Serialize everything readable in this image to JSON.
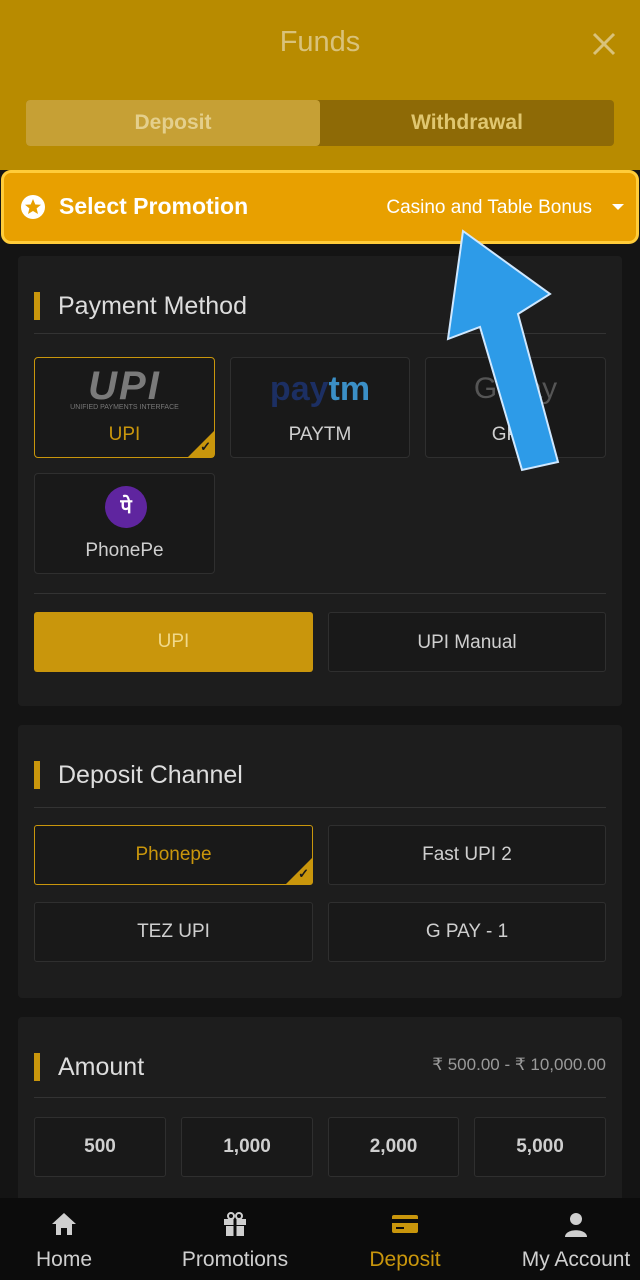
{
  "header": {
    "title": "Funds",
    "tabs": [
      {
        "label": "Deposit",
        "active": true
      },
      {
        "label": "Withdrawal",
        "active": false
      }
    ]
  },
  "promotion": {
    "label": "Select Promotion",
    "value": "Casino and Table Bonus"
  },
  "payment": {
    "title": "Payment Method",
    "methods": [
      {
        "label": "UPI",
        "selected": true
      },
      {
        "label": "PAYTM",
        "selected": false
      },
      {
        "label": "GPay",
        "selected": false
      },
      {
        "label": "PhonePe",
        "selected": false
      }
    ],
    "upi_logo": "UPI",
    "upi_logo_sub": "UNIFIED PAYMENTS INTERFACE",
    "paytm_logo_a": "pay",
    "paytm_logo_b": "tm",
    "phonepe_glyph": "पे",
    "gpay_logo": "G Pay",
    "options": [
      {
        "label": "UPI",
        "selected": true
      },
      {
        "label": "UPI Manual",
        "selected": false
      }
    ]
  },
  "channel": {
    "title": "Deposit Channel",
    "items": [
      {
        "label": "Phonepe",
        "selected": true
      },
      {
        "label": "Fast UPI 2",
        "selected": false
      },
      {
        "label": "TEZ UPI",
        "selected": false
      },
      {
        "label": "G PAY - 1",
        "selected": false
      }
    ]
  },
  "amount": {
    "title": "Amount",
    "range": "₹ 500.00 - ₹ 10,000.00",
    "presets": [
      "500",
      "1,000",
      "2,000",
      "5,000"
    ]
  },
  "nav": {
    "items": [
      {
        "label": "Home",
        "icon": "home-icon"
      },
      {
        "label": "Promotions",
        "icon": "gift-icon"
      },
      {
        "label": "Deposit",
        "icon": "card-icon",
        "active": true
      },
      {
        "label": "My Account",
        "icon": "user-icon"
      }
    ]
  },
  "colors": {
    "accent": "#c9960c",
    "promo_bg": "#e8a000",
    "header_bg": "#b88b00",
    "arrow": "#2d9be8"
  }
}
